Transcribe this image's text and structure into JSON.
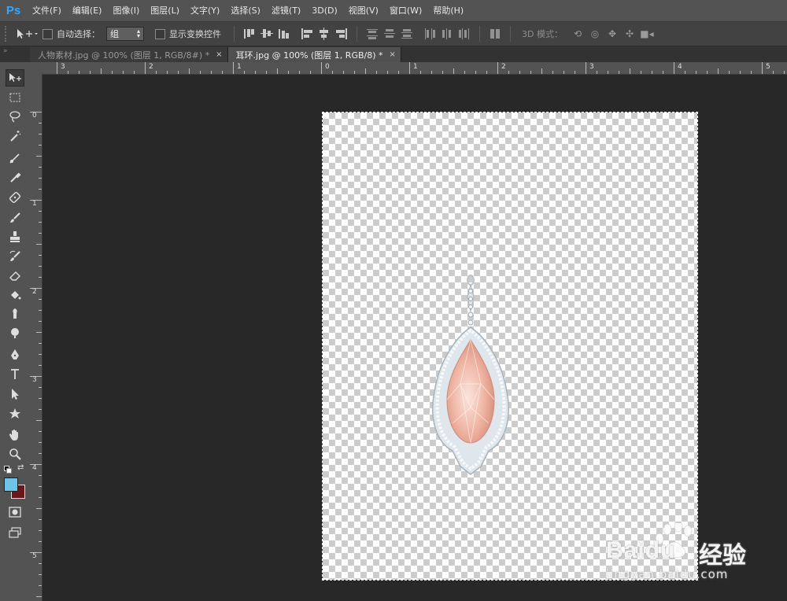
{
  "app": {
    "logo": "Ps"
  },
  "menu": [
    "文件(F)",
    "编辑(E)",
    "图像(I)",
    "图层(L)",
    "文字(Y)",
    "选择(S)",
    "滤镜(T)",
    "3D(D)",
    "视图(V)",
    "窗口(W)",
    "帮助(H)"
  ],
  "options": {
    "auto_select_label": "自动选择：",
    "auto_select_value": "组",
    "show_transform_label": "显示变换控件",
    "mode_label": "3D 模式："
  },
  "tabs": [
    {
      "label": "人物素材.jpg @ 100% (图层 1, RGB/8#) *",
      "close": "×",
      "active": false
    },
    {
      "label": "耳环.jpg @ 100% (图层 1, RGB/8) *",
      "close": "×",
      "active": true
    }
  ],
  "panel_toggle": "»",
  "ruler_top": [
    "3",
    "2",
    "1",
    "0",
    "1",
    "2",
    "3",
    "4",
    "5"
  ],
  "ruler_left": [
    "0",
    "1",
    "2",
    "3",
    "4",
    "5"
  ],
  "tools": [
    "move-tool",
    "marquee-tool",
    "lasso-tool",
    "magic-wand-tool",
    "crop-tool",
    "eyedropper-tool",
    "spot-healing-tool",
    "brush-tool",
    "clone-stamp-tool",
    "history-brush-tool",
    "eraser-tool",
    "paint-bucket-tool",
    "blur-tool",
    "dodge-tool",
    "pen-tool",
    "type-tool",
    "path-selection-tool",
    "shape-tool",
    "hand-tool",
    "zoom-tool"
  ],
  "colors": {
    "foreground": "#6ec4e8",
    "background": "#6b1618",
    "accent": "#31a8ff"
  },
  "watermark": {
    "brand": "Baidu",
    "suffix": "经验",
    "url": "jingyan.baidu.com"
  }
}
